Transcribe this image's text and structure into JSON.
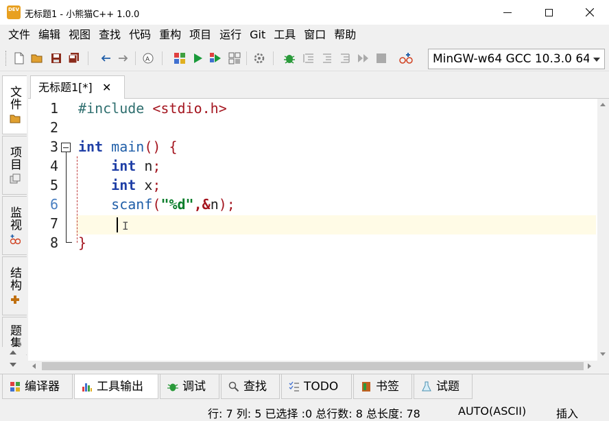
{
  "window": {
    "title": "无标题1  - 小熊猫C++ 1.0.0",
    "app_icon_text": "DEV"
  },
  "menu": [
    "文件",
    "编辑",
    "视图",
    "查找",
    "代码",
    "重构",
    "项目",
    "运行",
    "Git",
    "工具",
    "窗口",
    "帮助"
  ],
  "toolbar": {
    "compiler_select": "MinGW-w64 GCC 10.3.0 64"
  },
  "left_tabs": [
    {
      "label": "文件",
      "icon": "folder-icon"
    },
    {
      "label": "项目",
      "icon": "project-icon"
    },
    {
      "label": "监视",
      "icon": "watch-icon"
    },
    {
      "label": "结构",
      "icon": "structure-icon"
    },
    {
      "label": "题集",
      "icon": "problemset-icon"
    }
  ],
  "editor": {
    "tab_label": "无标题1[*]",
    "tab_close": "✕",
    "line_numbers": [
      "1",
      "2",
      "3",
      "4",
      "5",
      "6",
      "7",
      "8"
    ],
    "ibeam_glyph": "I"
  },
  "bottom_tabs": [
    {
      "label": "编译器",
      "icon": "compiler-icon"
    },
    {
      "label": "工具输出",
      "icon": "tool-output-icon"
    },
    {
      "label": "调试",
      "icon": "debug-icon"
    },
    {
      "label": "查找",
      "icon": "search-icon"
    },
    {
      "label": "TODO",
      "icon": "todo-icon"
    },
    {
      "label": "书签",
      "icon": "bookmark-icon"
    },
    {
      "label": "试题",
      "icon": "problem-icon"
    }
  ],
  "status": {
    "position": "行: 7 列: 5 已选择 :0 总行数: 8 总长度: 78",
    "encoding": "AUTO(ASCII)",
    "insert_mode": "插入"
  },
  "code": {
    "line1_include": "#include",
    "line1_header": "<stdio.h>",
    "line3_kw": "int",
    "line3_fn": "main",
    "line3_parens": "()",
    "line3_brace": "{",
    "line4_kw": "int",
    "line4_var": "n",
    "line5_kw": "int",
    "line5_var": "x",
    "line6_fn": "scanf",
    "line6_str": "\"%d\"",
    "line6_amp": "&",
    "line6_var": "n",
    "semicolon": ";",
    "open_paren": "(",
    "close_paren": ")",
    "comma": ",",
    "line8_brace": "}"
  }
}
